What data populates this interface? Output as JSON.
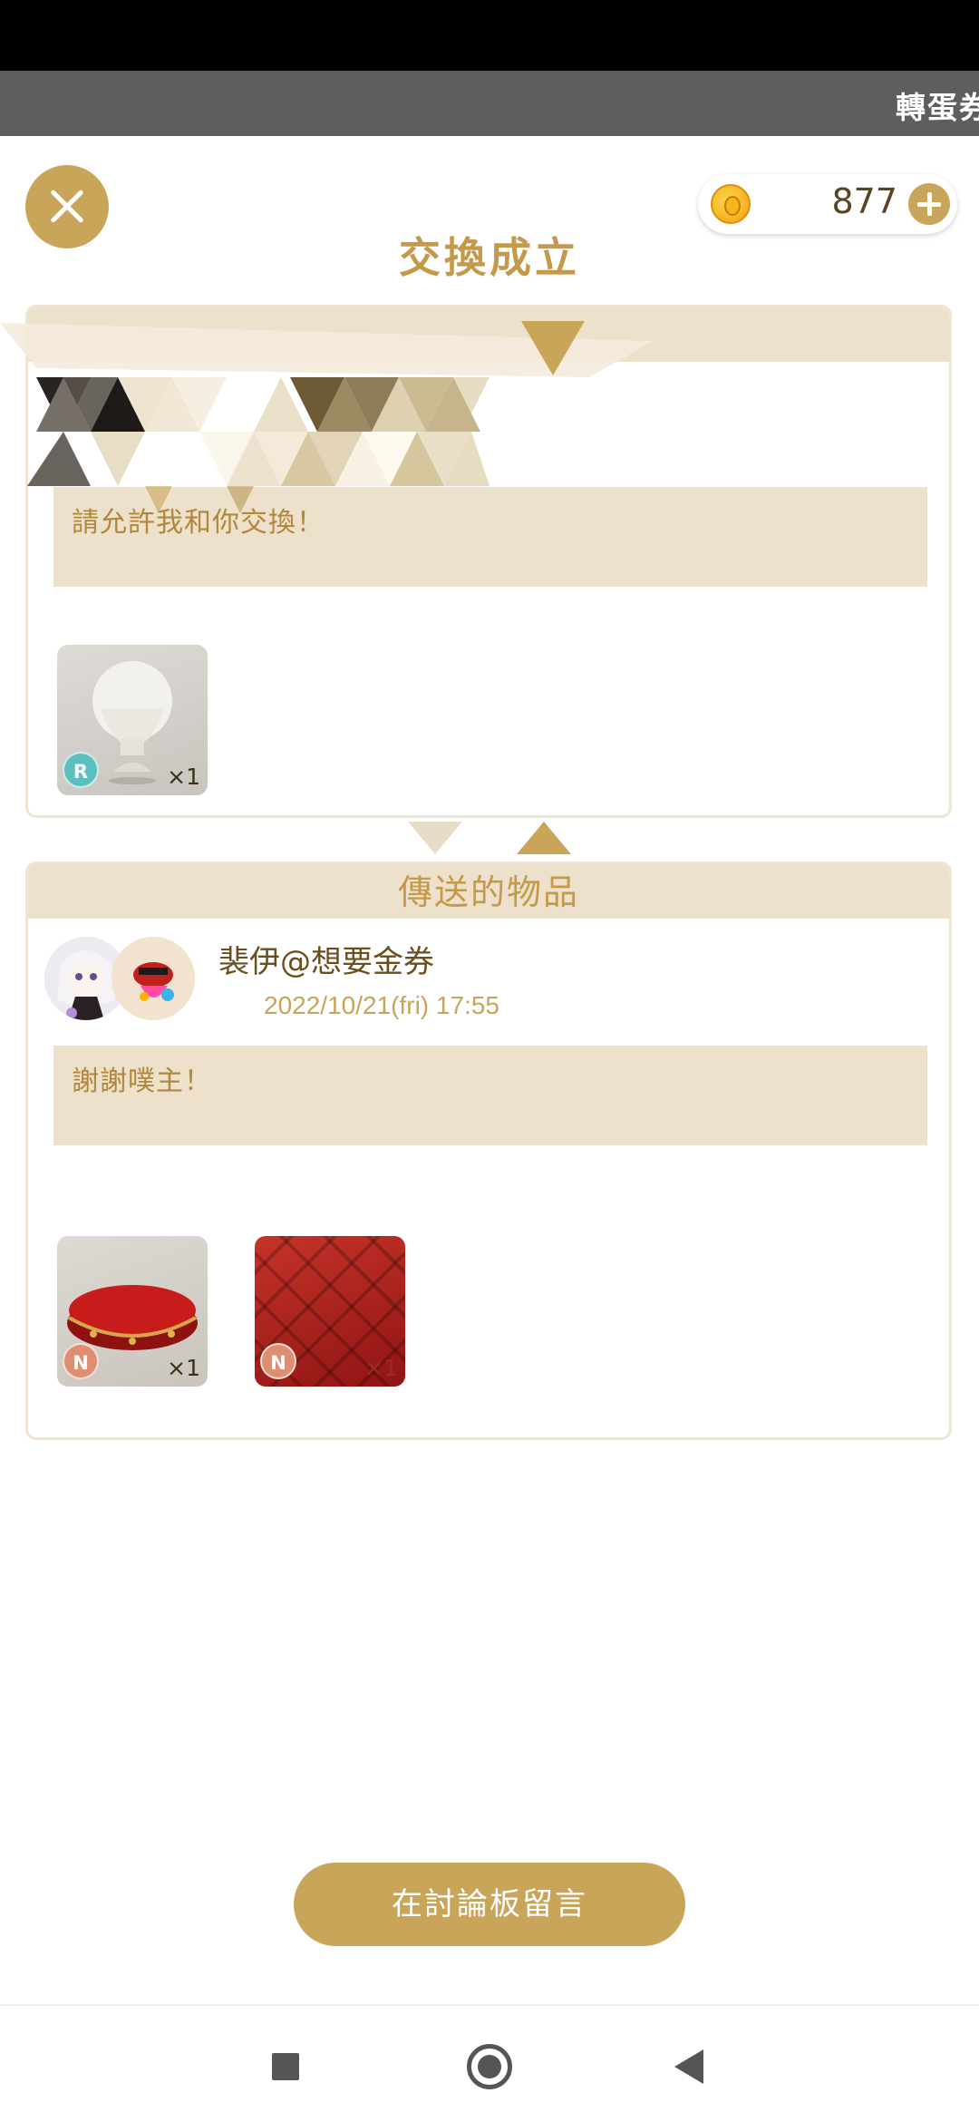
{
  "ticker": {
    "text": "轉蛋券"
  },
  "header": {
    "title": "交換成立",
    "coins": "877"
  },
  "request_card": {
    "message": "請允許我和你交換！",
    "item": {
      "rarity": "R",
      "quantity": "×1"
    }
  },
  "sent_card": {
    "header": "傳送的物品",
    "sender_name": "裴伊@想要金券",
    "timestamp": "2022/10/21(fri) 17:55",
    "message": "謝謝噗主！",
    "items": [
      {
        "rarity": "N",
        "quantity": "×1"
      },
      {
        "rarity": "N",
        "quantity": "×1"
      }
    ]
  },
  "actions": {
    "board_button": "在討論板留言"
  },
  "colors": {
    "accent": "#c9a55a",
    "panel": "#ede1cc",
    "title": "#c49a4a"
  }
}
